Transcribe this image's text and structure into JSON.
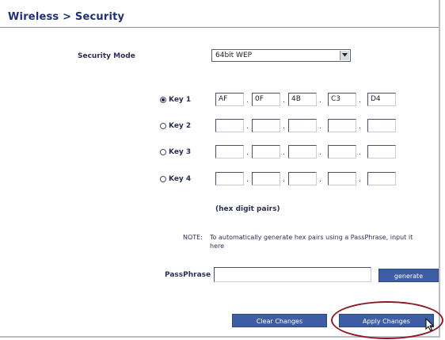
{
  "header": {
    "title": "Wireless > Security"
  },
  "security_mode": {
    "label": "Security Mode",
    "value": "64bit WEP"
  },
  "keys": [
    {
      "label": "Key 1",
      "selected": true,
      "values": [
        "AF",
        "0F",
        "4B",
        "C3",
        "D4"
      ]
    },
    {
      "label": "Key 2",
      "selected": false,
      "values": [
        "",
        "",
        "",
        "",
        ""
      ]
    },
    {
      "label": "Key 3",
      "selected": false,
      "values": [
        "",
        "",
        "",
        "",
        ""
      ]
    },
    {
      "label": "Key 4",
      "selected": false,
      "values": [
        "",
        "",
        "",
        "",
        ""
      ]
    }
  ],
  "hex_hint": "(hex digit pairs)",
  "note": {
    "tag": "NOTE:",
    "text": "To automatically generate hex pairs using a PassPhrase, input it here"
  },
  "passphrase": {
    "label": "PassPhrase",
    "value": "",
    "generate_label": "generate"
  },
  "buttons": {
    "clear": "Clear Changes",
    "apply": "Apply Changes"
  },
  "colors": {
    "title": "#1e2f7a",
    "button": "#3d5ea3",
    "highlight_circle": "#8c1b25"
  },
  "icons": {
    "select_arrow": "chevron-down-icon",
    "cursor": "mouse-pointer-icon"
  }
}
